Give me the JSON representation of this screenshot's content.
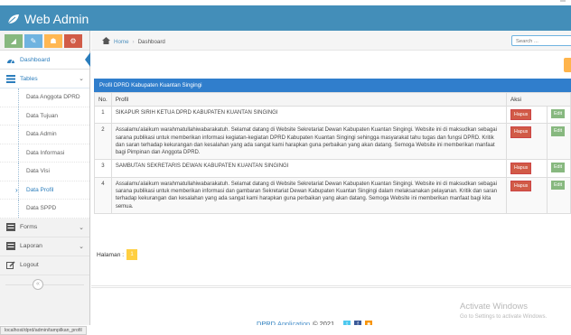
{
  "app": {
    "title": "Web Admin"
  },
  "sidebar": {
    "items": [
      {
        "label": "Dashboard"
      },
      {
        "label": "Tables"
      },
      {
        "label": "Forms"
      },
      {
        "label": "Laporan"
      },
      {
        "label": "Logout"
      }
    ],
    "tables_submenu": [
      {
        "label": "Data Anggota DPRD"
      },
      {
        "label": "Data Tujuan"
      },
      {
        "label": "Data Admin"
      },
      {
        "label": "Data Informasi"
      },
      {
        "label": "Data Visi"
      },
      {
        "label": "Data Profil"
      },
      {
        "label": "Data SPPD"
      }
    ],
    "collapse_icon": "double-chevron-left-icon"
  },
  "breadcrumb": {
    "home": "Home",
    "current": "Dashboard"
  },
  "search": {
    "placeholder": "Search ..."
  },
  "panel": {
    "title": "Profil DPRD Kabupaten Kuantan Singingi"
  },
  "table": {
    "headers": {
      "no": "No.",
      "profil": "Profil",
      "aksi": "Aksi"
    },
    "rows": [
      {
        "no": "1",
        "profil": "SIKAPUR SIRIH KETUA DPRD KABUPATEN KUANTAN SINGINGI",
        "delete": "Hapus",
        "edit": "Edit"
      },
      {
        "no": "2",
        "profil": "Assalamu'alaikum warahmatullahiwabarakatuh. Selamat datang di Website Sekretariat Dewan Kabupaten Kuantan Singingi. Website ini di maksudkan sebagai sarana publikasi untuk memberikan informasi kegiatan-kegiatan DPRD Kabupaten Kuantan Singingi sehingga masyarakat tahu tugas dan fungsi DPRD. Kritik dan saran terhadap kekurangan dan kesalahan yang ada sangat kami harapkan guna perbaikan yang akan datang. Semoga Website ini memberikan manfaat bagi Pimpinan dan Anggota DPRD.",
        "delete": "Hapus",
        "edit": "Edit"
      },
      {
        "no": "3",
        "profil": "SAMBUTAN SEKRETARIS DEWAN KABUPATEN KUANTAN SINGINGI",
        "delete": "Hapus",
        "edit": "Edit"
      },
      {
        "no": "4",
        "profil": "Assalamu'alaikum warahmatullahiwabarakatuh. Selamat datang di Website Sekretariat Dewan Kabupaten Kuantan Singingi. Website ini di maksudkan sebagai sarana publikasi untuk memberikan informasi dan gambaran Sekretariat Dewan Kabupaten Kuantan Singingi dalam melaksanakan pelayanan. Kritik dan saran terhadap kekurangan dan kesalahan yang ada sangat kami harapkan guna perbaikan yang akan datang. Semoga Website ini memberikan manfaat bagi kita semua.",
        "delete": "Hapus",
        "edit": "Edit"
      }
    ]
  },
  "pagination": {
    "label": "Halaman :",
    "current": "1"
  },
  "footer": {
    "app": "DPRD",
    "text": "Application",
    "year": "© 2021"
  },
  "watermark": {
    "line1": "Activate Windows",
    "line2": "Go to Settings to activate Windows."
  },
  "statusbar": {
    "url": "localhost/dprd/admin/tampilkan_profil"
  },
  "colors": {
    "navbar": "#438eb9",
    "panel_header": "#307ecc",
    "delete": "#d15b47",
    "edit": "#87b87f",
    "page": "#ffcf41"
  }
}
